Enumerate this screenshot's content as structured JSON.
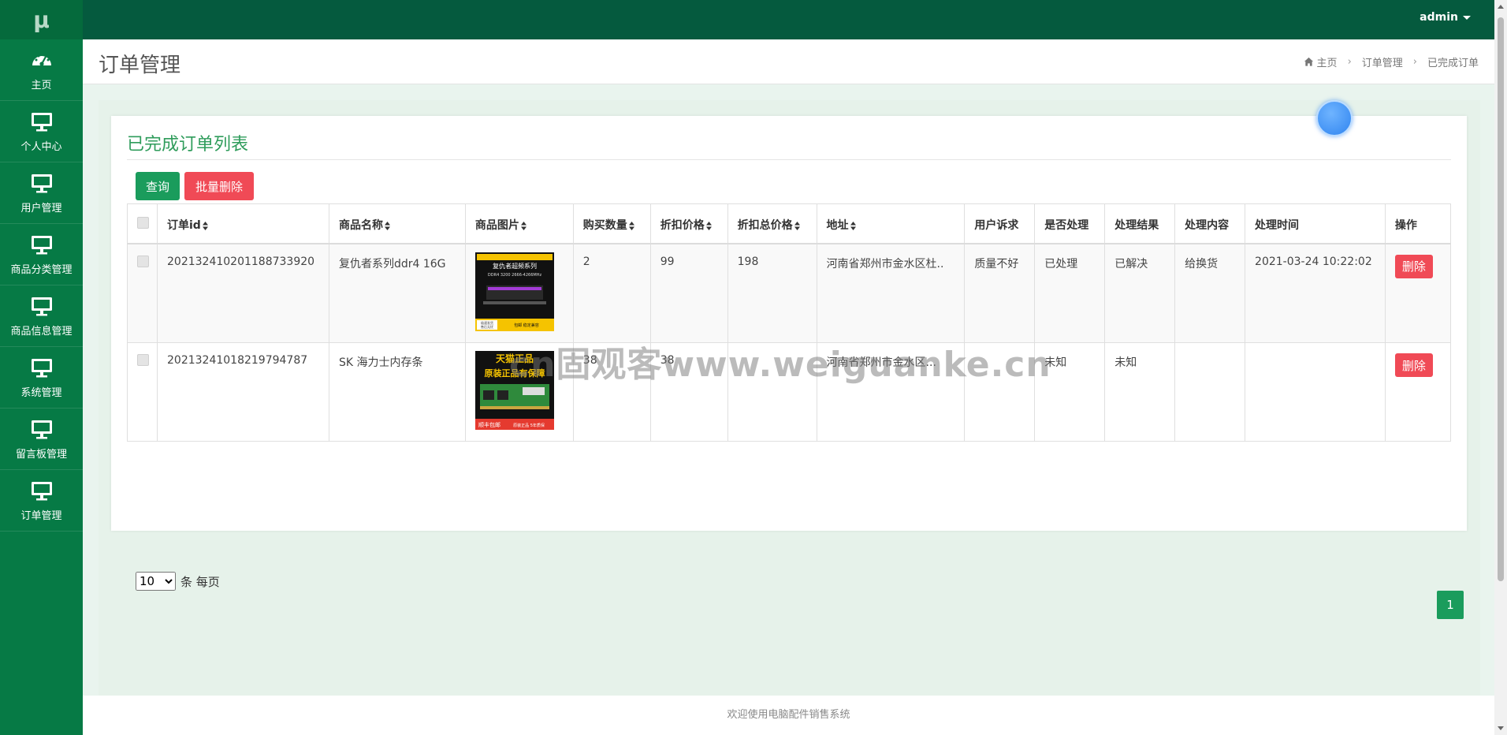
{
  "sidebar": {
    "logo": "μ",
    "items": [
      {
        "label": "主页",
        "icon": "dashboard-icon"
      },
      {
        "label": "个人中心",
        "icon": "monitor-icon"
      },
      {
        "label": "用户管理",
        "icon": "monitor-icon"
      },
      {
        "label": "商品分类管理",
        "icon": "monitor-icon"
      },
      {
        "label": "商品信息管理",
        "icon": "monitor-icon"
      },
      {
        "label": "系统管理",
        "icon": "monitor-icon"
      },
      {
        "label": "留言板管理",
        "icon": "monitor-icon"
      },
      {
        "label": "订单管理",
        "icon": "monitor-icon"
      }
    ]
  },
  "topbar": {
    "user": "admin"
  },
  "header": {
    "title": "订单管理",
    "breadcrumb": [
      "主页",
      "订单管理",
      "已完成订单"
    ]
  },
  "panel": {
    "title": "已完成订单列表",
    "query_label": "查询",
    "batch_delete_label": "批量删除"
  },
  "table": {
    "columns": [
      "订单id",
      "商品名称",
      "商品图片",
      "购买数量",
      "折扣价格",
      "折扣总价格",
      "地址",
      "用户诉求",
      "是否处理",
      "处理结果",
      "处理内容",
      "处理时间",
      "操作"
    ],
    "rows": [
      {
        "order_id": "202132410201188733920",
        "product": "复仇者系列ddr4 16G",
        "image_texts": [
          "复仇者超频系列",
          "DDR4 3200 2666-4266MHz",
          "极速发货",
          "售后无忧",
          "包邮 稳定兼容"
        ],
        "qty": "2",
        "price": "99",
        "total": "198",
        "address": "河南省郑州市金水区杜..",
        "demand": "质量不好",
        "handled": "已处理",
        "result": "已解决",
        "content": "给换货",
        "time": "2021-03-24 10:22:02",
        "action": "删除"
      },
      {
        "order_id": "202132410182197947​87",
        "product": "SK 海力士内存条",
        "image_texts": [
          "天猫正品",
          "原装正品有保障",
          "顺丰包邮",
          "原装正品 5年质保"
        ],
        "qty": "38",
        "price": "38",
        "total": "",
        "address": "河南省郑州市金水区...",
        "demand": "",
        "handled": "未知",
        "result": "未知",
        "content": "",
        "time": "",
        "action": "删除"
      }
    ]
  },
  "pager": {
    "page_size": "10",
    "page_size_suffix": "条 每页",
    "current_page": "1"
  },
  "footer": {
    "text": "欢迎使用电脑配件销售系统"
  },
  "watermark": "cn固观客www.weiguanke.cn",
  "colors": {
    "sidebar": "#067a45",
    "topbar": "#055a3e",
    "accent": "#1a9c5c",
    "danger": "#f04a56"
  }
}
